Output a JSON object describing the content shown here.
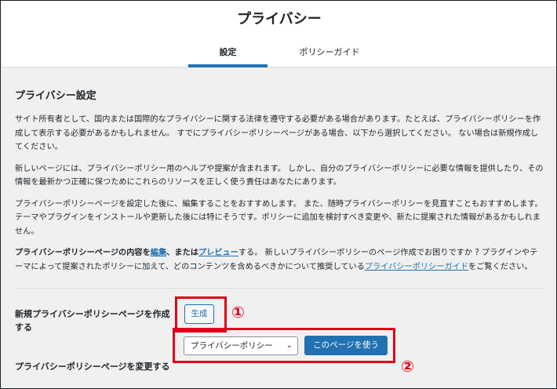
{
  "header": {
    "title": "プライバシー",
    "tabs": [
      {
        "label": "設定",
        "active": true
      },
      {
        "label": "ポリシーガイド",
        "active": false
      }
    ]
  },
  "section": {
    "title": "プライバシー設定",
    "p1": "サイト所有者として、国内または国際的なプライバシーに関する法律を遵守する必要がある場合があります。たとえば、プライバシーポリシーを作成して表示する必要があるかもしれません。 すでにプライバシーポリシーページがある場合、以下から選択してください。 ない場合は新規作成してください。",
    "p2": "新しいページには、プライバシーポリシー用のヘルプや提案が含まれます。 しかし、自分のプライバシーポリシーに必要な情報を提供したり、その情報を最新かつ正確に保つためにこれらのリソースを正しく使う責任はあなたにあります。",
    "p3": "プライバシーポリシーページを設定した後に、編集することをおすすめします。 また、随時プライバシーポリシーを見直すこともおすすめします。テーマやプラグインをインストールや更新した後には特にそうです。ポリシーに追加を検討すべき変更や、新たに提案された情報があるかもしれません。",
    "p4": {
      "lead": "プライバシーポリシーページの内容を",
      "edit_link": "編集",
      "mid": "、または",
      "preview_link": "プレビュー",
      "after_preview": "する。 新しいプライバシーポリシーのページ作成でお困りですか ? プラグインやテーマによって提案されたポリシーに加えて、どのコンテンツを含めるべきかについて推奨している",
      "guide_link": "プライバシーポリシーガイド",
      "tail": "をご覧ください。"
    }
  },
  "create_row": {
    "label": "新規プライバシーポリシーページを作成する",
    "button": "生成"
  },
  "change_row": {
    "label": "プライバシーポリシーページを変更する",
    "selected": "プライバシーポリシー",
    "use_button": "このページを使う"
  },
  "annotations": {
    "marker1": "①",
    "marker2": "②",
    "color": "#e0001b"
  },
  "colors": {
    "accent": "#2271b1",
    "background": "#f0f0f1"
  }
}
